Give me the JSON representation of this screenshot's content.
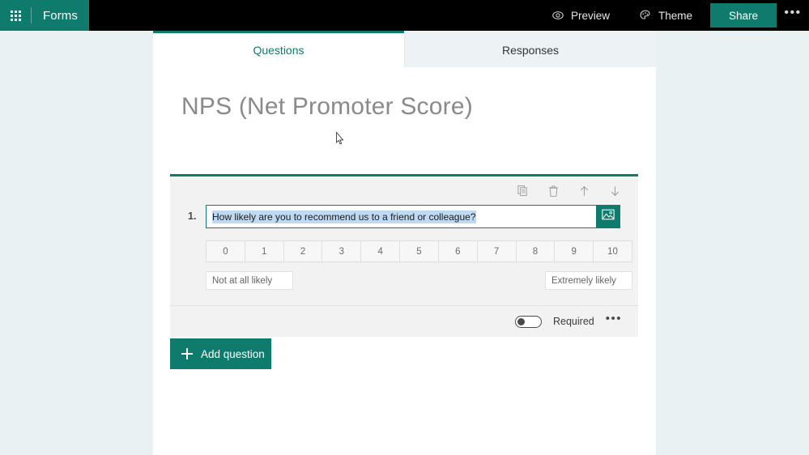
{
  "topbar": {
    "waffle_icon": "app-launcher-waffle-icon",
    "brand": "Forms",
    "preview": {
      "label": "Preview",
      "icon": "eye-icon"
    },
    "theme": {
      "label": "Theme",
      "icon": "palette-icon"
    },
    "share": {
      "label": "Share"
    },
    "more": {
      "label": "•••"
    }
  },
  "tabs": [
    {
      "label": "Questions",
      "active": true
    },
    {
      "label": "Responses",
      "active": false
    }
  ],
  "form": {
    "title": "NPS (Net Promoter Score)"
  },
  "question": {
    "number": "1.",
    "text": "How likely are you to recommend us to a friend or colleague?",
    "text_selected": true,
    "image_button_icon": "picture-icon",
    "toolbar": [
      {
        "icon": "copy-icon",
        "label": "Copy question"
      },
      {
        "icon": "trash-icon",
        "label": "Delete question"
      },
      {
        "icon": "arrow-up-icon",
        "label": "Move question up"
      },
      {
        "icon": "arrow-down-icon",
        "label": "Move question down"
      }
    ],
    "scale": [
      "0",
      "1",
      "2",
      "3",
      "4",
      "5",
      "6",
      "7",
      "8",
      "9",
      "10"
    ],
    "label_low": "Not at all likely",
    "label_high": "Extremely likely",
    "required": {
      "label": "Required",
      "on": false
    },
    "more_options": "•••"
  },
  "actions": {
    "add_question": "Add question"
  },
  "colors": {
    "brand_teal": "#0f7b6c",
    "topbar_black": "#000000",
    "page_bg": "#eaf1f2",
    "content_bg": "#ffffff",
    "card_bg": "#f2f2f2",
    "selection_blue": "#bfd9f2",
    "title_gray": "#8a8a8a"
  }
}
